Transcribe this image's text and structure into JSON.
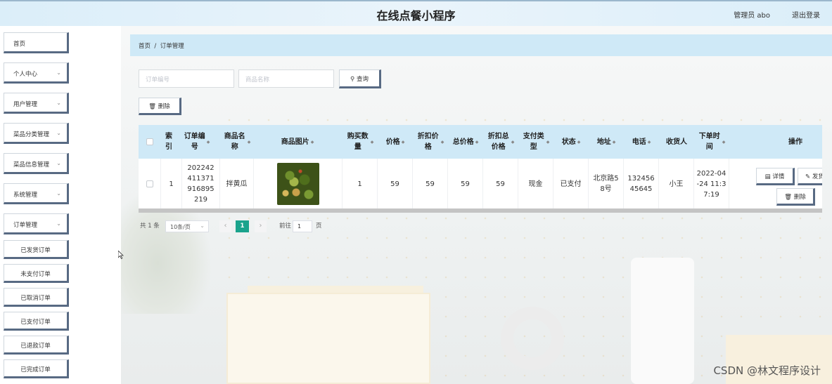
{
  "app": {
    "title": "在线点餐小程序",
    "user": "管理员 abo",
    "logout": "退出登录"
  },
  "sidebar": {
    "items": [
      {
        "label": "首页",
        "has_children": false
      },
      {
        "label": "个人中心",
        "has_children": true
      },
      {
        "label": "用户管理",
        "has_children": true
      },
      {
        "label": "菜品分类管理",
        "has_children": true
      },
      {
        "label": "菜品信息管理",
        "has_children": true
      },
      {
        "label": "系统管理",
        "has_children": true
      },
      {
        "label": "订单管理",
        "has_children": true
      }
    ],
    "sub_items": [
      "已发货订单",
      "未支付订单",
      "已取消订单",
      "已支付订单",
      "已退款订单",
      "已完成订单"
    ]
  },
  "breadcrumb": {
    "home": "首页",
    "separator": "/",
    "current": "订单管理"
  },
  "search": {
    "order_no_placeholder": "订单编号",
    "product_name_placeholder": "商品名称",
    "query_label": "查询"
  },
  "toolbar": {
    "delete_label": "删除"
  },
  "table": {
    "columns": [
      "索引",
      "订单编号",
      "商品名称",
      "商品图片",
      "购买数量",
      "价格",
      "折扣价格",
      "总价格",
      "折扣总价格",
      "支付类型",
      "状态",
      "地址",
      "电话",
      "收货人",
      "下单时间",
      "操作"
    ],
    "rows": [
      {
        "index": "1",
        "order_no": "202242411371916895219",
        "product_name": "拌黄瓜",
        "quantity": "1",
        "price": "59",
        "discount_price": "59",
        "total_price": "59",
        "discount_total": "59",
        "pay_type": "现金",
        "status": "已支付",
        "address": "北京路58号",
        "phone": "13245645645",
        "receiver": "小王",
        "order_time": "2022-04-24 11:37:19"
      }
    ],
    "actions": {
      "detail": "详情",
      "ship": "发货",
      "delete": "删除"
    }
  },
  "pagination": {
    "total": "共 1 条",
    "page_size": "10条/页",
    "current_page": "1",
    "goto_label": "前往",
    "goto_value": "1",
    "page_suffix": "页"
  },
  "watermark": "CSDN @林文程序设计",
  "colors": {
    "accent": "#1aa38c",
    "header_bg": "#cfe9f7",
    "button_shadow": "#586a83"
  }
}
